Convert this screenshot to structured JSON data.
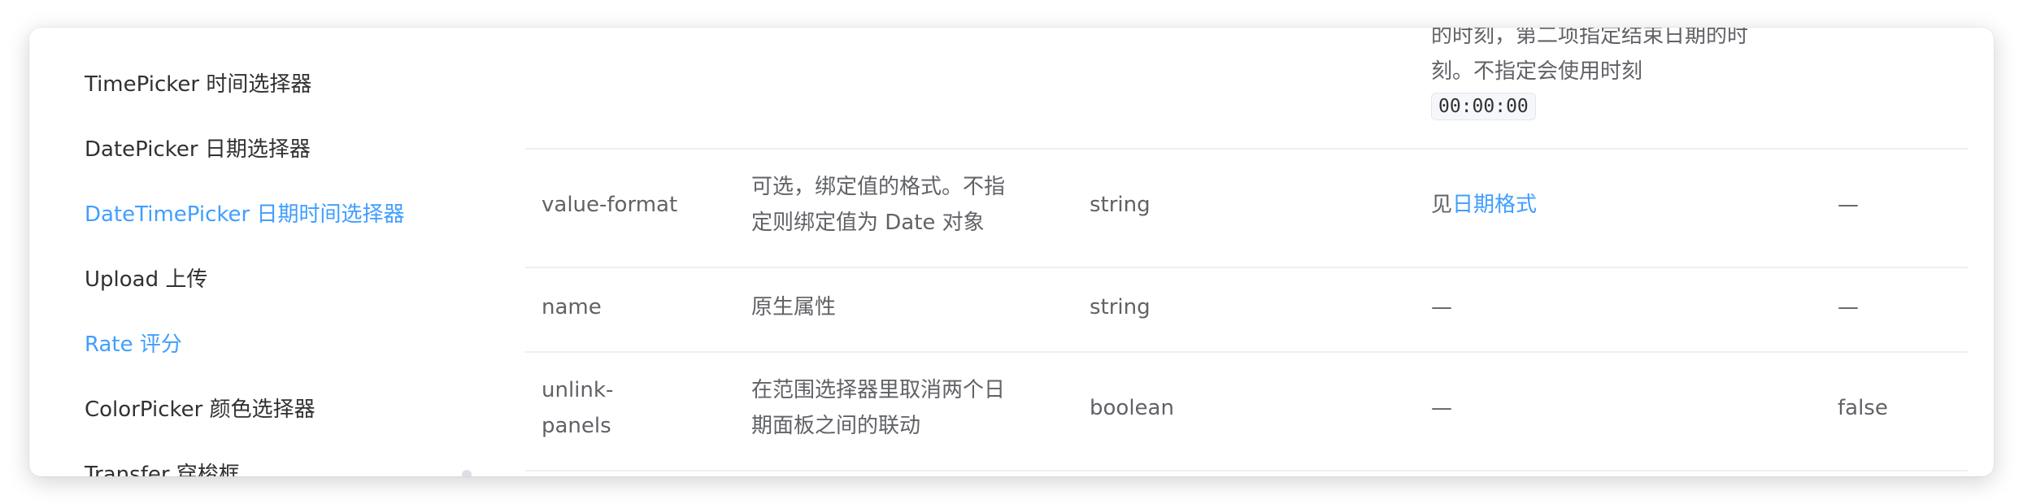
{
  "sidebar": {
    "items": [
      {
        "label": "TimePicker 时间选择器"
      },
      {
        "label": "DatePicker 日期选择器"
      },
      {
        "label": "DateTimePicker 日期时间选择器"
      },
      {
        "label": "Upload 上传"
      },
      {
        "label": "Rate 评分"
      },
      {
        "label": "ColorPicker 颜色选择器"
      },
      {
        "label": "Transfer 穿梭框"
      }
    ]
  },
  "table": {
    "top_row": {
      "description_lines": [
        "的时刻，第二项指定结束日期的时",
        "刻。不指定会使用时刻"
      ],
      "code": "00:00:00"
    },
    "rows": [
      {
        "param": "value-format",
        "description_lines": [
          "可选，绑定值的格式。不指",
          "定则绑定值为 Date 对象"
        ],
        "type": "string",
        "options_prefix": "见",
        "options_link": "日期格式",
        "default": "—"
      },
      {
        "param": "name",
        "description": "原生属性",
        "type": "string",
        "options": "—",
        "default": "—"
      },
      {
        "param_lines": [
          "unlink-",
          "panels"
        ],
        "description_lines": [
          "在范围选择器里取消两个日",
          "期面板之间的联动"
        ],
        "type": "boolean",
        "options": "—",
        "default": "false"
      }
    ]
  },
  "colors": {
    "accent": "#409eff",
    "text": "#606266",
    "nav_text": "#303133",
    "border": "#ebeef5"
  }
}
